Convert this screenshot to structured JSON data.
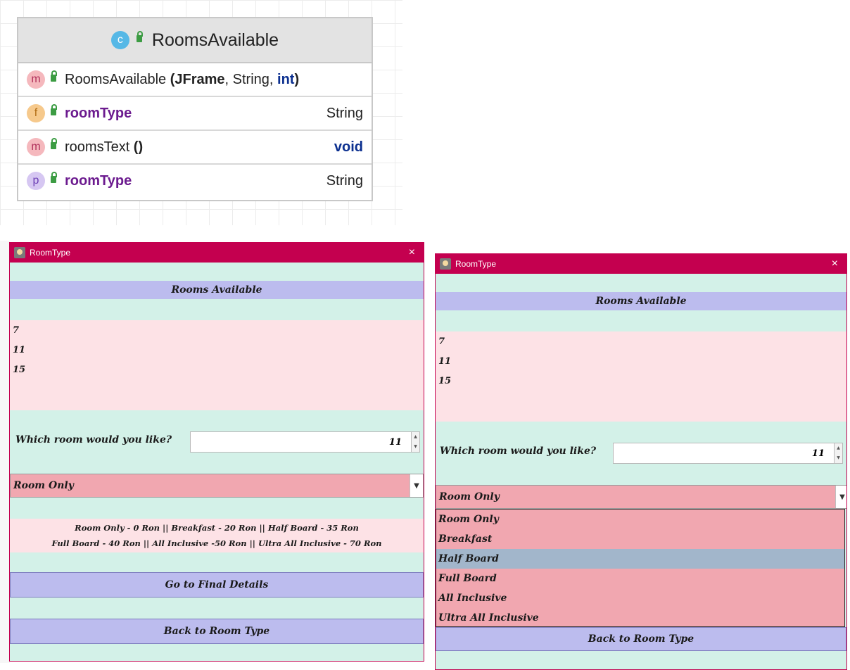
{
  "uml": {
    "class_badge": "c",
    "class_name": "RoomsAvailable",
    "members": [
      {
        "badge": "m",
        "name": "RoomsAvailable",
        "params_open": " (JFrame",
        "params_mid": ", String, ",
        "params_kw": "int",
        "params_close": ")",
        "type": ""
      },
      {
        "badge": "f",
        "name": "roomType",
        "type": "String"
      },
      {
        "badge": "m",
        "name": "roomsText",
        "parens": " ()",
        "type": "void"
      },
      {
        "badge": "p",
        "name": "roomType",
        "type": "String"
      }
    ],
    "colors": {
      "badge_m": "#f5b8bd",
      "badge_f": "#f6c98c",
      "badge_p": "#d6c7f2",
      "badge_c": "#56b8e6"
    }
  },
  "windows": [
    {
      "title": "RoomType",
      "close_glyph": "×",
      "heading": "Rooms Available",
      "rooms": [
        "7",
        "11",
        "15"
      ],
      "question": "Which room would you like?",
      "spinner_value": "11",
      "combo_selected": "Room Only",
      "prices_line1": "Room Only - 0 Ron || Breakfast - 20 Ron || Half Board - 35 Ron",
      "prices_line2": "Full Board - 40 Ron || All Inclusive -50 Ron || Ultra All Inclusive - 70 Ron",
      "final_button": "Go to Final Details",
      "back_button": "Back to Room Type"
    },
    {
      "title": "RoomType",
      "close_glyph": "×",
      "heading": "Rooms Available",
      "rooms": [
        "7",
        "11",
        "15"
      ],
      "question": "Which room would you like?",
      "spinner_value": "11",
      "combo_selected": "Room Only",
      "dropdown_options": [
        "Room Only",
        "Breakfast",
        "Half Board",
        "Full Board",
        "All Inclusive",
        "Ultra All Inclusive"
      ],
      "dropdown_highlighted": "Half Board",
      "back_button": "Back to Room Type"
    }
  ],
  "colors": {
    "titlebar": "#c4004f",
    "window_bg": "#d3f1e8",
    "heading_band": "#bcbcee",
    "list_band": "#fde2e6",
    "combo": "#f1a7b0",
    "dropdown_highlight": "#a2b6cb"
  }
}
